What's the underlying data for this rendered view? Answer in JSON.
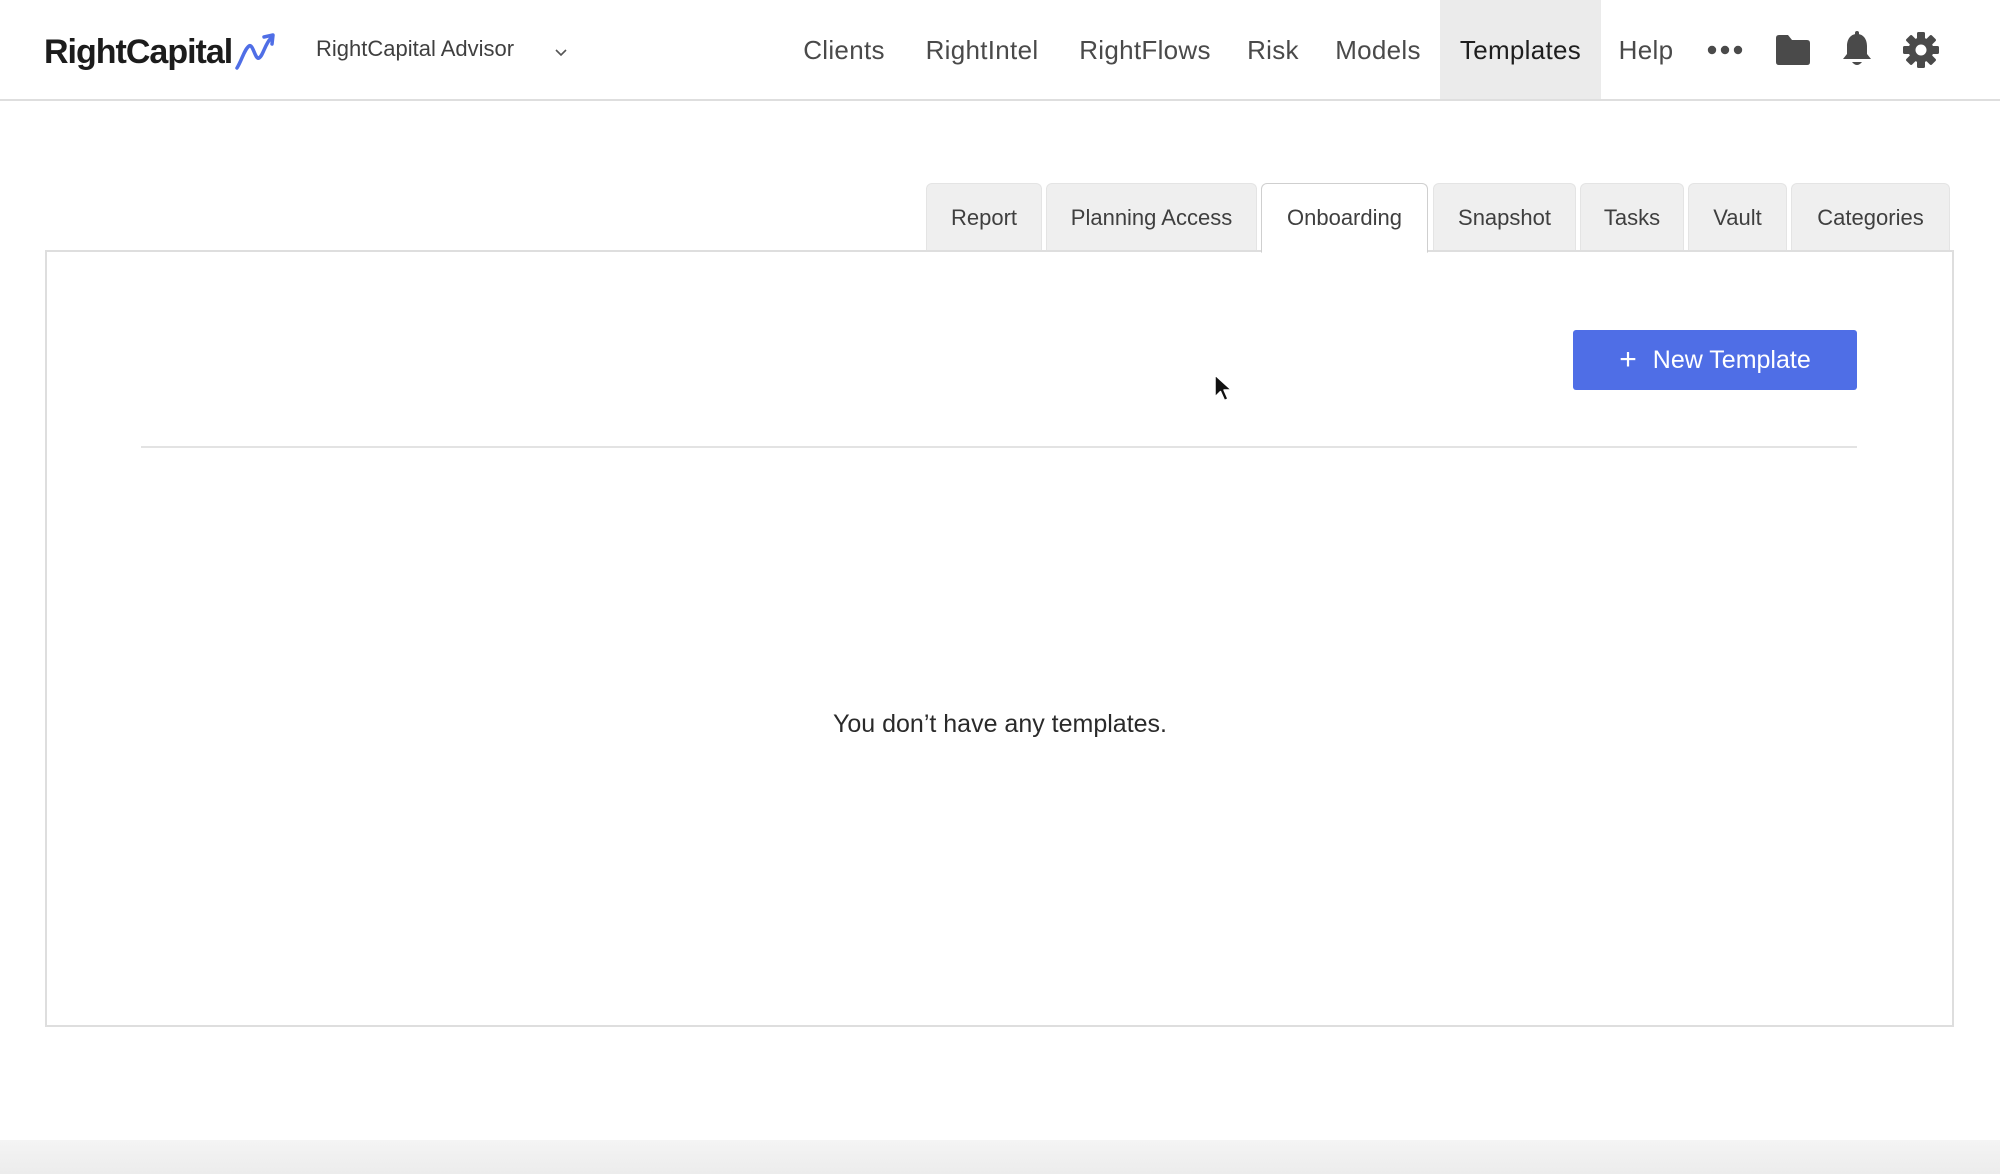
{
  "brand": {
    "logo_text": "RightCapital",
    "accent": "#4f6ee6"
  },
  "header": {
    "account_label": "RightCapital Advisor",
    "nav": [
      {
        "label": "Clients"
      },
      {
        "label": "RightIntel"
      },
      {
        "label": "RightFlows"
      },
      {
        "label": "Risk"
      },
      {
        "label": "Models"
      },
      {
        "label": "Templates",
        "active": true
      },
      {
        "label": "Help"
      }
    ],
    "icons": [
      "more-icon",
      "folder-icon",
      "bell-icon",
      "gear-icon"
    ]
  },
  "tabs": [
    {
      "label": "Report"
    },
    {
      "label": "Planning Access"
    },
    {
      "label": "Onboarding",
      "active": true
    },
    {
      "label": "Snapshot"
    },
    {
      "label": "Tasks"
    },
    {
      "label": "Vault"
    },
    {
      "label": "Categories"
    }
  ],
  "main": {
    "new_template_label": "New Template",
    "empty_message": "You don’t have any templates."
  }
}
